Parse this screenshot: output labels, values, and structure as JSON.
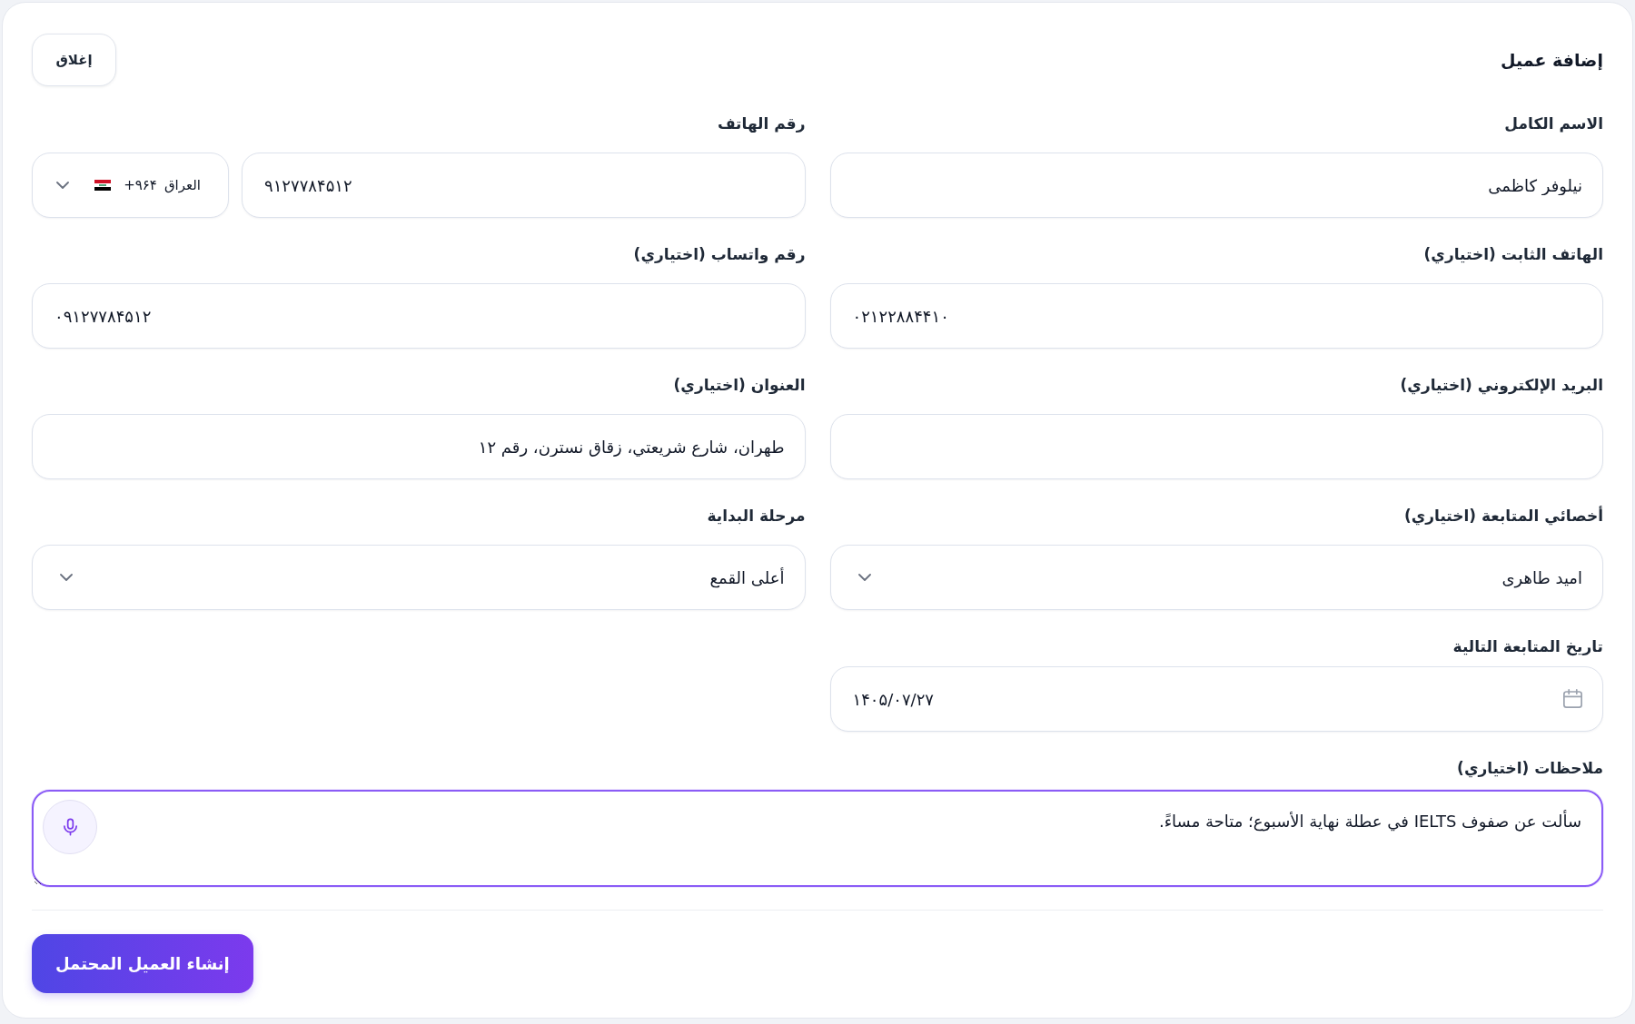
{
  "dialog": {
    "title": "إضافة عميل",
    "close_button": "إغلاق"
  },
  "fields": [
    {
      "kind": "text",
      "label": "الاسم الكامل",
      "value": "نيلوفر كاظمی"
    },
    {
      "kind": "phone",
      "label": "رقم الهاتف",
      "country": "العراق",
      "dial_code": "+۹۶۴",
      "value": "۹۱۲۷۷۸۴۵۱۲"
    },
    {
      "kind": "number",
      "label": "الهاتف الثابت (اختياري)",
      "value": "۰۲۱۲۲۸۸۴۴۱۰"
    },
    {
      "kind": "number",
      "label": "رقم واتساب (اختياري)",
      "value": "۰۹۱۲۷۷۸۴۵۱۲"
    },
    {
      "kind": "text",
      "label": "البريد الإلكتروني (اختياري)"
    },
    {
      "kind": "text",
      "label": "العنوان (اختياري)",
      "value": "طهران، شارع شريعتي، زقاق نسترن، رقم ۱۲"
    },
    {
      "kind": "select",
      "label": "أخصائي المتابعة (اختياري)",
      "value": "امید طاهری"
    },
    {
      "kind": "select",
      "label": "مرحلة البداية",
      "value": "أعلى القمع"
    },
    {
      "kind": "date",
      "label": "تاريخ المتابعة التالية",
      "value": "۱۴۰۵/۰۷/۲۷"
    }
  ],
  "notes": {
    "label": "ملاحظات (اختياري)",
    "value": "سألت عن صفوف IELTS في عطلة نهاية الأسبوع؛ متاحة مساءً.",
    "focused": true
  },
  "submit_button": "إنشاء العميل المحتمل"
}
